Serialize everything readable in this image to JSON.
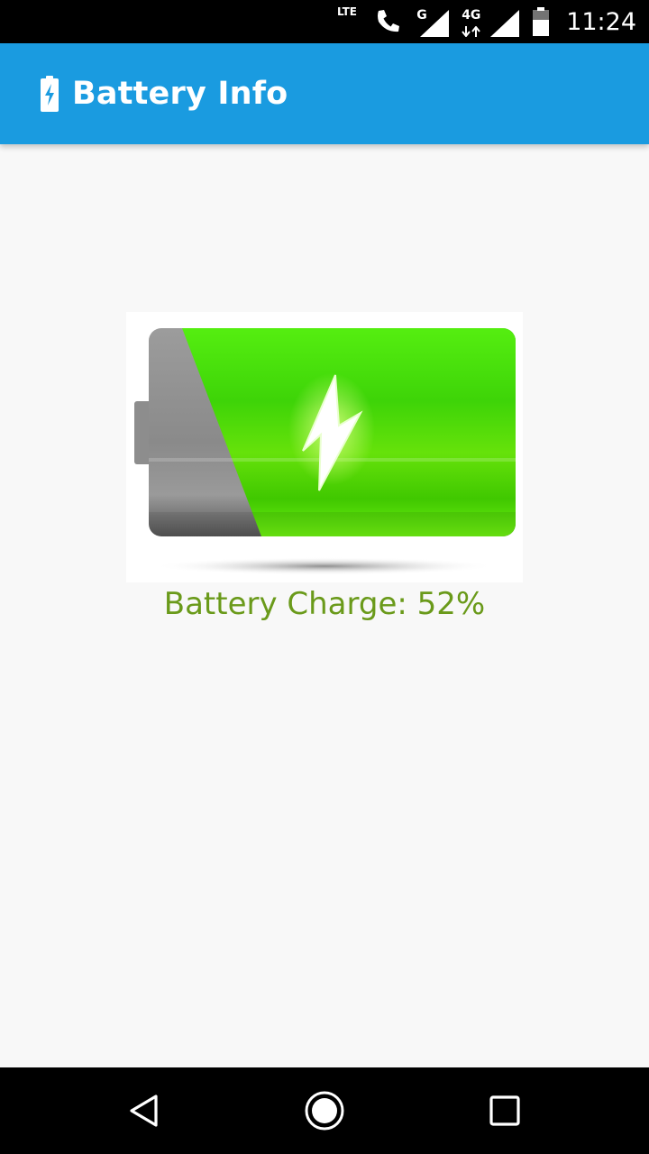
{
  "status_bar": {
    "time": "11:24",
    "icons": [
      "lte-call-icon",
      "signal-g-icon",
      "signal-4g-icon",
      "battery-icon"
    ],
    "net_g": "G",
    "net_4g": "4G",
    "lte": "LTE"
  },
  "app_bar": {
    "title": "Battery Info",
    "icon": "battery-charging-icon",
    "color": "#1a9be0"
  },
  "battery": {
    "level_percent": 52,
    "icon": "lightning-bolt-icon"
  },
  "charge_text": "Battery Charge: 52%",
  "charge_text_color": "#6a9a1a",
  "nav_bar": {
    "items": [
      "back-icon",
      "home-icon",
      "recents-icon"
    ]
  }
}
